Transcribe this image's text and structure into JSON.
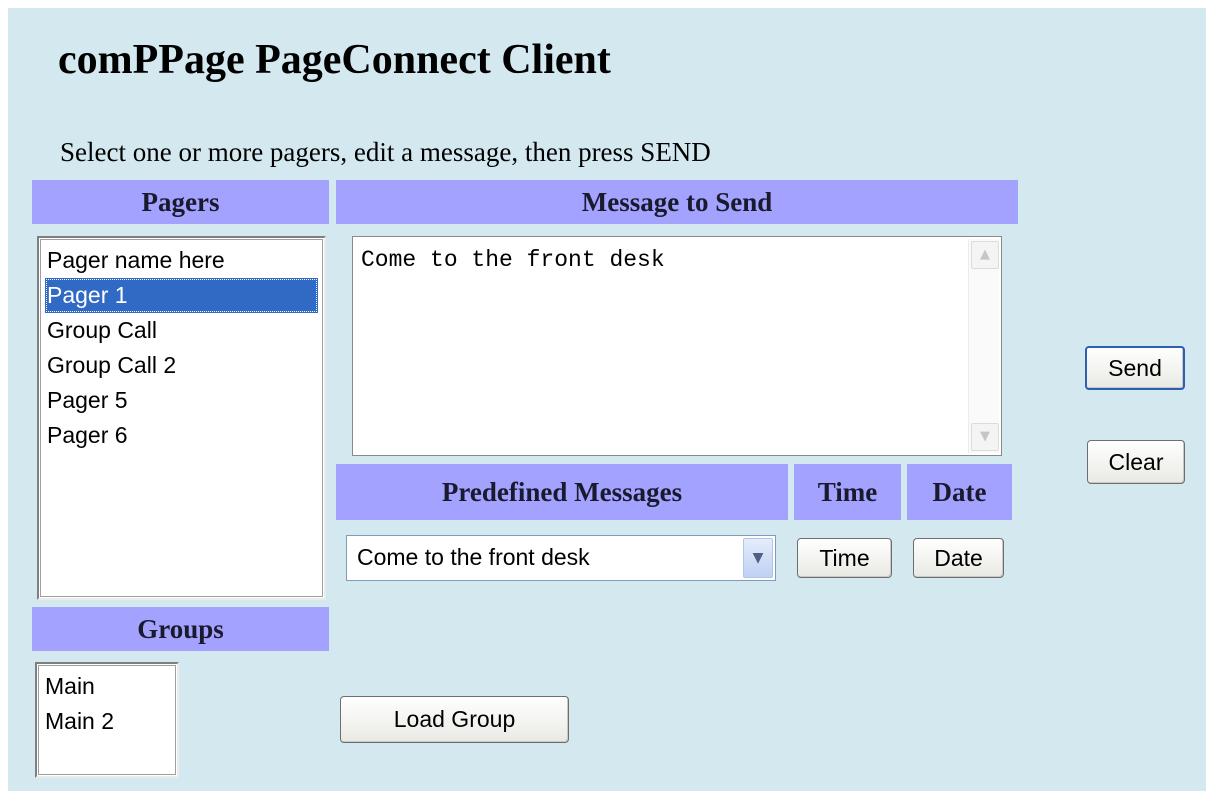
{
  "header": {
    "title": "comPPage PageConnect Client",
    "instructions": "Select one or more pagers, edit a message, then press SEND"
  },
  "pagers": {
    "heading": "Pagers",
    "items": [
      {
        "label": "Pager name here",
        "selected": false
      },
      {
        "label": "Pager 1",
        "selected": true
      },
      {
        "label": "Group Call",
        "selected": false
      },
      {
        "label": "Group Call 2",
        "selected": false
      },
      {
        "label": "Pager 5",
        "selected": false
      },
      {
        "label": "Pager 6",
        "selected": false
      }
    ]
  },
  "message": {
    "heading": "Message to Send",
    "value": "Come to the front desk"
  },
  "predefined": {
    "heading": "Predefined Messages",
    "selected": "Come to the front desk",
    "dropdown_icon": "chevron-down-icon"
  },
  "time": {
    "heading": "Time",
    "button_label": "Time"
  },
  "date": {
    "heading": "Date",
    "button_label": "Date"
  },
  "actions": {
    "send_label": "Send",
    "clear_label": "Clear"
  },
  "groups": {
    "heading": "Groups",
    "items": [
      {
        "label": "Main"
      },
      {
        "label": "Main 2"
      }
    ],
    "load_label": "Load Group"
  },
  "colors": {
    "background": "#d4e9ef",
    "header_band": "#a3a3ff",
    "selection": "#316ac5"
  }
}
